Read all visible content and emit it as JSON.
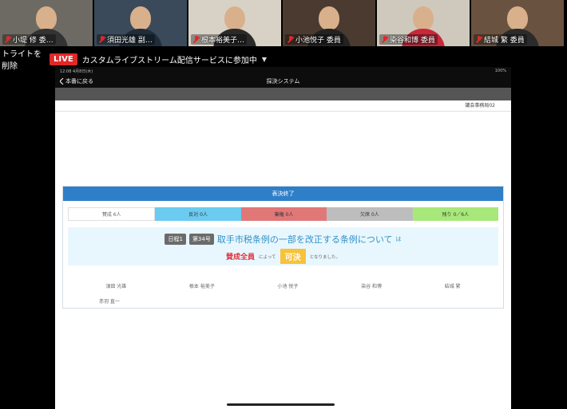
{
  "participants": [
    {
      "name": "小堤 修 委…",
      "bg": "#6d6a63",
      "width": 116
    },
    {
      "name": "須田光雄 副…",
      "bg": "#3a4a5a",
      "width": 116
    },
    {
      "name": "根本裕美子…",
      "bg": "#d8d2c6",
      "width": 116
    },
    {
      "name": "小池悦子 委員",
      "bg": "#4a3a30",
      "width": 116
    },
    {
      "name": "染谷和博 委員",
      "bg": "#cfc9bd",
      "width": 116
    },
    {
      "name": "結城 繁 委員",
      "bg": "#6a5240",
      "width": 116
    }
  ],
  "toolbar": {
    "remove_label": "トライトを削除",
    "live_label": "LIVE",
    "stream_label": "カスタムライブストリーム配信サービスに参加中",
    "caret": "▼"
  },
  "tablet": {
    "status_time": "12:08 4月8日(木)",
    "status_right": "100%",
    "back_label": "本番に戻る",
    "nav_title": "採決システム",
    "secretariat": "議会事務局02",
    "panel_title": "表決終了",
    "counts": [
      {
        "label": "賛成 6人"
      },
      {
        "label": "反対 0人"
      },
      {
        "label": "棄権 0人"
      },
      {
        "label": "欠席 0人"
      },
      {
        "label": "残り 0／6人"
      }
    ],
    "result": {
      "agenda_tag": "日程1",
      "number_tag": "第34号",
      "bill_title": "取手市税条例の一部を改正する条例について",
      "particle_wa": "は",
      "unanimous": "賛成全員",
      "by": "によって",
      "passed": "可決",
      "ending": "となりました。"
    },
    "members_row1": [
      "須田 光雄",
      "根本 裕美子",
      "小池 悦子",
      "染谷 和博",
      "結城 繁"
    ],
    "members_row2": [
      "赤羽 直一"
    ]
  }
}
